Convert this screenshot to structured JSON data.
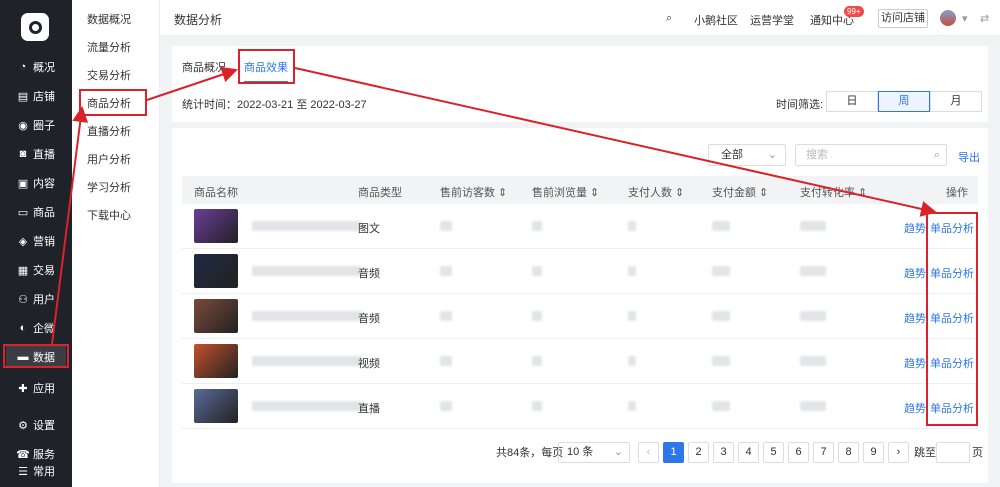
{
  "sidebar": {
    "items": [
      {
        "icon": "pie-chart-icon",
        "glyph": "◔",
        "label": "概况"
      },
      {
        "icon": "store-icon",
        "glyph": "▤",
        "label": "店铺"
      },
      {
        "icon": "community-icon",
        "glyph": "◉",
        "label": "圈子"
      },
      {
        "icon": "live-icon",
        "glyph": "◙",
        "label": "直播"
      },
      {
        "icon": "content-icon",
        "glyph": "▣",
        "label": "内容"
      },
      {
        "icon": "goods-icon",
        "glyph": "▭",
        "label": "商品"
      },
      {
        "icon": "marketing-icon",
        "glyph": "◈",
        "label": "营销"
      },
      {
        "icon": "trade-icon",
        "glyph": "▦",
        "label": "交易"
      },
      {
        "icon": "user-icon",
        "glyph": "⚇",
        "label": "用户"
      },
      {
        "icon": "enterprise-wechat-icon",
        "glyph": "◐",
        "label": "企微"
      },
      {
        "icon": "data-icon",
        "glyph": "▬",
        "label": "数据"
      },
      {
        "icon": "apps-icon",
        "glyph": "✚",
        "label": "应用"
      },
      {
        "icon": "settings-icon",
        "glyph": "⚙",
        "label": "设置"
      },
      {
        "icon": "service-icon",
        "glyph": "☎",
        "label": "服务"
      },
      {
        "icon": "common-icon",
        "glyph": "☰",
        "label": "常用"
      }
    ]
  },
  "submenu": {
    "items": [
      "数据概况",
      "流量分析",
      "交易分析",
      "商品分析",
      "直播分析",
      "用户分析",
      "学习分析",
      "下载中心"
    ]
  },
  "header": {
    "title": "数据分析",
    "links": [
      "小鹅社区",
      "运营学堂",
      "通知中心"
    ],
    "badge": "99+",
    "visit_store": "访问店铺"
  },
  "tabs": [
    "商品概况",
    "商品效果"
  ],
  "stat_time": "统计时间：2022-03-21 至 2022-03-27",
  "time_filter": {
    "label": "时间筛选:",
    "options": [
      "日",
      "周",
      "月"
    ],
    "selected": "周"
  },
  "toolbar": {
    "select_value": "全部",
    "search_placeholder": "搜索",
    "export": "导出"
  },
  "table": {
    "columns": [
      "商品名称",
      "商品类型",
      "售前访客数 ⇕",
      "售前浏览量 ⇕",
      "支付人数 ⇕",
      "支付金额 ⇕",
      "支付转化率 ⇕",
      "操作"
    ],
    "rows": [
      {
        "type": "图文",
        "thumb": "#6a3d9a"
      },
      {
        "type": "音频",
        "thumb": "#1e2a44"
      },
      {
        "type": "音频",
        "thumb": "#7a4a3a"
      },
      {
        "type": "视频",
        "thumb": "#c4502a"
      },
      {
        "type": "直播",
        "thumb": "#5a6a9a"
      }
    ],
    "action_trend": "趋势",
    "action_single": "单品分析"
  },
  "pagination": {
    "total": "共84条，每页",
    "page_size": "10 条",
    "pages": [
      "1",
      "2",
      "3",
      "4",
      "5",
      "6",
      "7",
      "8",
      "9"
    ],
    "current": "1",
    "jump_label": "跳至",
    "page_unit": "页"
  },
  "colors": {
    "accent": "#2f76e8",
    "annotation": "#d9222a",
    "sidebar": "#1f2329"
  }
}
